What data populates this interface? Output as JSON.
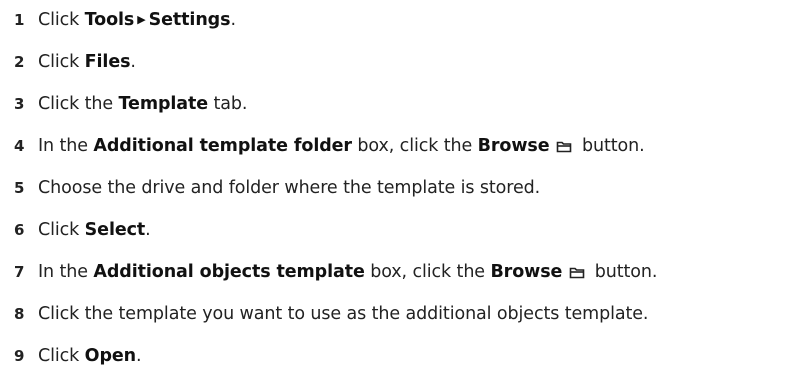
{
  "steps": [
    {
      "number": "1",
      "pre": "Click ",
      "b1": "Tools",
      "arrow": "▶",
      "b2": "Settings",
      "post": "."
    },
    {
      "number": "2",
      "pre": "Click ",
      "b1": "Files",
      "post": "."
    },
    {
      "number": "3",
      "pre": "Click the ",
      "b1": "Template",
      "post": " tab."
    },
    {
      "number": "4",
      "pre": "In the ",
      "b1": "Additional template folder",
      "mid": " box, click the ",
      "b2": "Browse",
      "icon": "folder-icon",
      "post": " button."
    },
    {
      "number": "5",
      "pre": "Choose the drive and folder where the template is stored."
    },
    {
      "number": "6",
      "pre": "Click ",
      "b1": "Select",
      "post": "."
    },
    {
      "number": "7",
      "pre": "In the ",
      "b1": "Additional objects template",
      "mid": " box, click the ",
      "b2": "Browse",
      "icon": "folder-icon",
      "post": " button."
    },
    {
      "number": "8",
      "pre": "Click the template you want to use as the additional objects template."
    },
    {
      "number": "9",
      "pre": "Click ",
      "b1": "Open",
      "post": "."
    }
  ]
}
